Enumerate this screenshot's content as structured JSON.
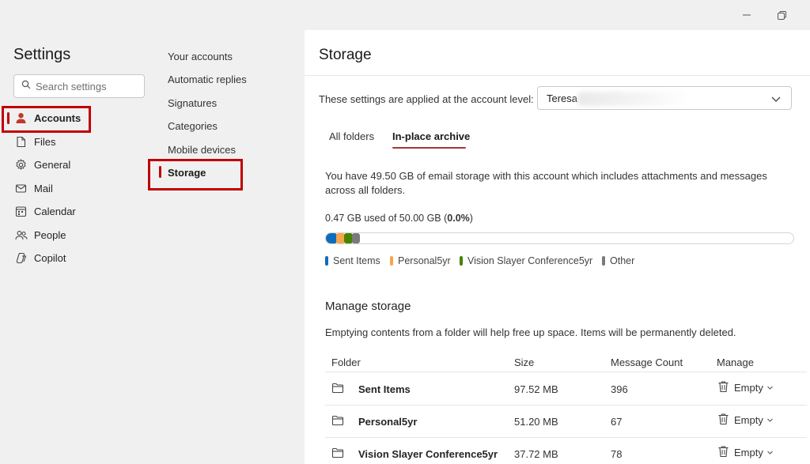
{
  "sidebar": {
    "title": "Settings",
    "search_placeholder": "Search settings",
    "items": [
      {
        "label": "Accounts"
      },
      {
        "label": "Files"
      },
      {
        "label": "General"
      },
      {
        "label": "Mail"
      },
      {
        "label": "Calendar"
      },
      {
        "label": "People"
      },
      {
        "label": "Copilot"
      }
    ]
  },
  "subnav": {
    "items": [
      {
        "label": "Your accounts"
      },
      {
        "label": "Automatic replies"
      },
      {
        "label": "Signatures"
      },
      {
        "label": "Categories"
      },
      {
        "label": "Mobile devices"
      },
      {
        "label": "Storage"
      }
    ]
  },
  "content": {
    "title": "Storage",
    "account_label": "These settings are applied at the account level:",
    "account_value": "Teresa",
    "tabs": [
      {
        "label": "All folders"
      },
      {
        "label": "In-place archive"
      }
    ],
    "description": "You have 49.50 GB of email storage with this account which includes attachments and messages across all folders.",
    "usage_prefix": "0.47 GB used of 50.00 GB (",
    "usage_percent": "0.0%",
    "usage_suffix": ")",
    "legend": [
      {
        "label": "Sent Items",
        "color": "#0f6cbd"
      },
      {
        "label": "Personal5yr",
        "color": "#f7a54a"
      },
      {
        "label": "Vision Slayer Conference5yr",
        "color": "#498205"
      },
      {
        "label": "Other",
        "color": "#7a7a7a"
      }
    ],
    "manage_title": "Manage storage",
    "manage_desc": "Emptying contents from a folder will help free up space. Items will be permanently deleted.",
    "table": {
      "headers": [
        "Folder",
        "Size",
        "Message Count",
        "Manage"
      ],
      "rows": [
        {
          "folder": "Sent Items",
          "size": "97.52 MB",
          "count": "396",
          "action": "Empty"
        },
        {
          "folder": "Personal5yr",
          "size": "51.20 MB",
          "count": "67",
          "action": "Empty"
        },
        {
          "folder": "Vision Slayer Conference5yr",
          "size": "37.72 MB",
          "count": "78",
          "action": "Empty"
        }
      ]
    }
  },
  "colors": {
    "accent": "#c00000",
    "tab_underline": "#a4373a"
  }
}
